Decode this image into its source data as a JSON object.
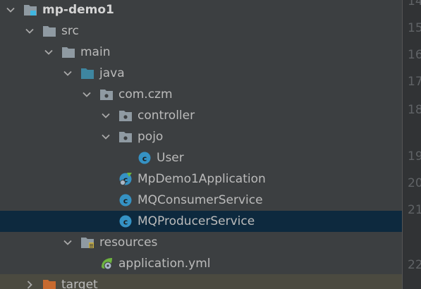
{
  "tree": [
    {
      "name": "tree-row-mp-demo1",
      "label": "mp-demo1",
      "icon": "module-folder-icon",
      "expanded": true,
      "bold": true,
      "level": 0
    },
    {
      "name": "tree-row-src",
      "label": "src",
      "icon": "folder-icon",
      "expanded": true,
      "level": 1
    },
    {
      "name": "tree-row-main",
      "label": "main",
      "icon": "folder-icon",
      "expanded": true,
      "level": 2
    },
    {
      "name": "tree-row-java",
      "label": "java",
      "icon": "source-folder-icon",
      "expanded": true,
      "level": 3
    },
    {
      "name": "tree-row-com-czm",
      "label": "com.czm",
      "icon": "package-icon",
      "expanded": true,
      "level": 4
    },
    {
      "name": "tree-row-controller",
      "label": "controller",
      "icon": "package-icon",
      "expanded": true,
      "level": 5
    },
    {
      "name": "tree-row-pojo",
      "label": "pojo",
      "icon": "package-icon",
      "expanded": true,
      "level": 5
    },
    {
      "name": "tree-row-user",
      "label": "User",
      "icon": "class-icon",
      "level": 6
    },
    {
      "name": "tree-row-mpdemo1application",
      "label": "MpDemo1Application",
      "icon": "spring-boot-class-icon",
      "level": 5
    },
    {
      "name": "tree-row-mqconsumerservice",
      "label": "MQConsumerService",
      "icon": "class-icon",
      "level": 5
    },
    {
      "name": "tree-row-mqproducerservice",
      "label": "MQProducerService",
      "icon": "class-icon",
      "level": 5,
      "selected": true
    },
    {
      "name": "tree-row-resources",
      "label": "resources",
      "icon": "resources-folder-icon",
      "expanded": true,
      "level": 3
    },
    {
      "name": "tree-row-application-yml",
      "label": "application.yml",
      "icon": "spring-yml-icon",
      "level": 4
    },
    {
      "name": "tree-row-target",
      "label": "target",
      "icon": "excluded-folder-icon",
      "expanded": false,
      "level": 1
    }
  ],
  "gutter": {
    "line_numbers": [
      "14",
      "15",
      "16",
      "17",
      "18",
      "19",
      "20",
      "21",
      "22"
    ]
  },
  "colors": {
    "panel_bg": "#3c3f41",
    "selection_bg": "#0d293e",
    "folder": "#8f9aa2",
    "source_folder": "#3e86a0",
    "class_icon": "#3592c4",
    "excluded_folder": "#c76a2f",
    "spring_green": "#6db33f"
  }
}
